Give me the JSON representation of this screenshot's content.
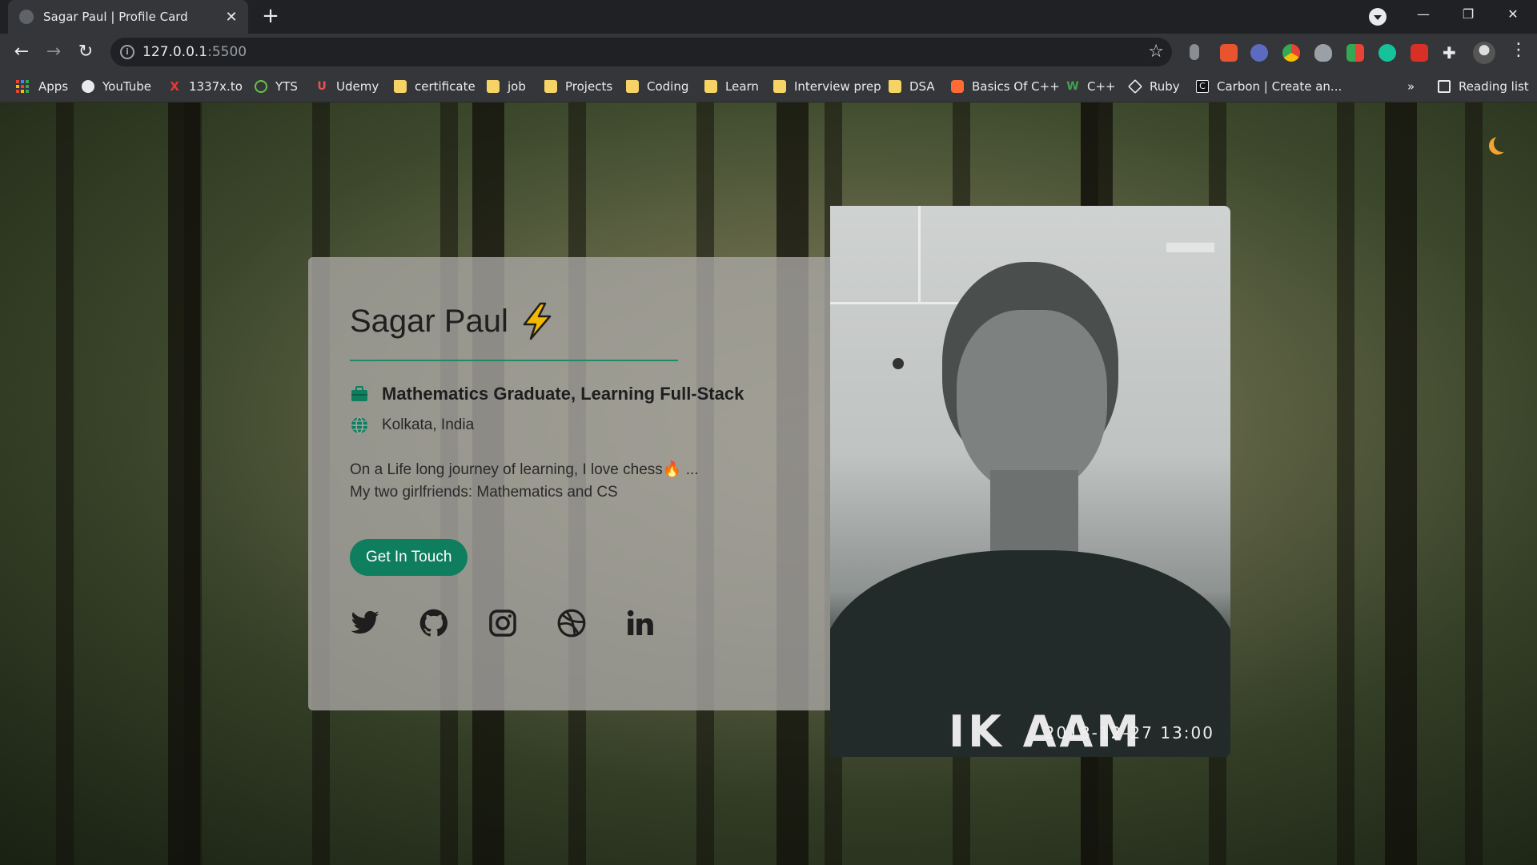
{
  "browser": {
    "tab_title": "Sagar Paul | Profile Card",
    "tab_close": "✕",
    "new_tab": "+",
    "url_host": "127.0.0.1",
    "url_port": ":5500",
    "window_controls": {
      "minimize": "—",
      "restore": "❐",
      "close": "✕"
    },
    "nav": {
      "back": "←",
      "forward": "→",
      "reload": "↻"
    },
    "bookmarks": [
      {
        "label": "Apps",
        "icon": "apps-grid-icon"
      },
      {
        "label": "YouTube",
        "icon": "globe-icon",
        "color": "#ffffff"
      },
      {
        "label": "1337x.to",
        "icon": "x-icon",
        "color": "#e53935"
      },
      {
        "label": "YTS",
        "icon": "yts-icon",
        "color": "#6ac045"
      },
      {
        "label": "Udemy",
        "icon": "udemy-icon",
        "color": "#ec5252"
      },
      {
        "label": "certificate",
        "icon": "folder-icon"
      },
      {
        "label": "job",
        "icon": "folder-icon"
      },
      {
        "label": "Projects",
        "icon": "folder-icon"
      },
      {
        "label": "Coding",
        "icon": "folder-icon"
      },
      {
        "label": "Learn",
        "icon": "folder-icon"
      },
      {
        "label": "Interview prep",
        "icon": "folder-icon"
      },
      {
        "label": "DSA",
        "icon": "folder-icon"
      },
      {
        "label": "Basics Of C++",
        "icon": "codechef-icon",
        "color": "#ff6b35"
      },
      {
        "label": "C++",
        "icon": "w-icon",
        "color": "#3fa34d"
      },
      {
        "label": "Ruby",
        "icon": "ruby-icon",
        "color": "#ffffff"
      },
      {
        "label": "Carbon | Create an...",
        "icon": "carbon-icon",
        "color": "#111111"
      }
    ],
    "overflow": "»",
    "reading_list": "Reading list"
  },
  "profile": {
    "name": "Sagar Paul",
    "title": "Mathematics Graduate, Learning Full-Stack",
    "location": "Kolkata, India",
    "bio_line1": "On a Life long journey of learning, I love chess🔥 ...",
    "bio_line2": "My two girlfriends: Mathematics and CS",
    "cta_label": "Get In Touch",
    "socials": [
      "twitter",
      "github",
      "instagram",
      "dribbble",
      "linkedin"
    ],
    "accent_color": "#0f7e5e"
  },
  "photo": {
    "timestamp": "2018-12-27 13:00",
    "shirt_text": "IK AAM"
  }
}
